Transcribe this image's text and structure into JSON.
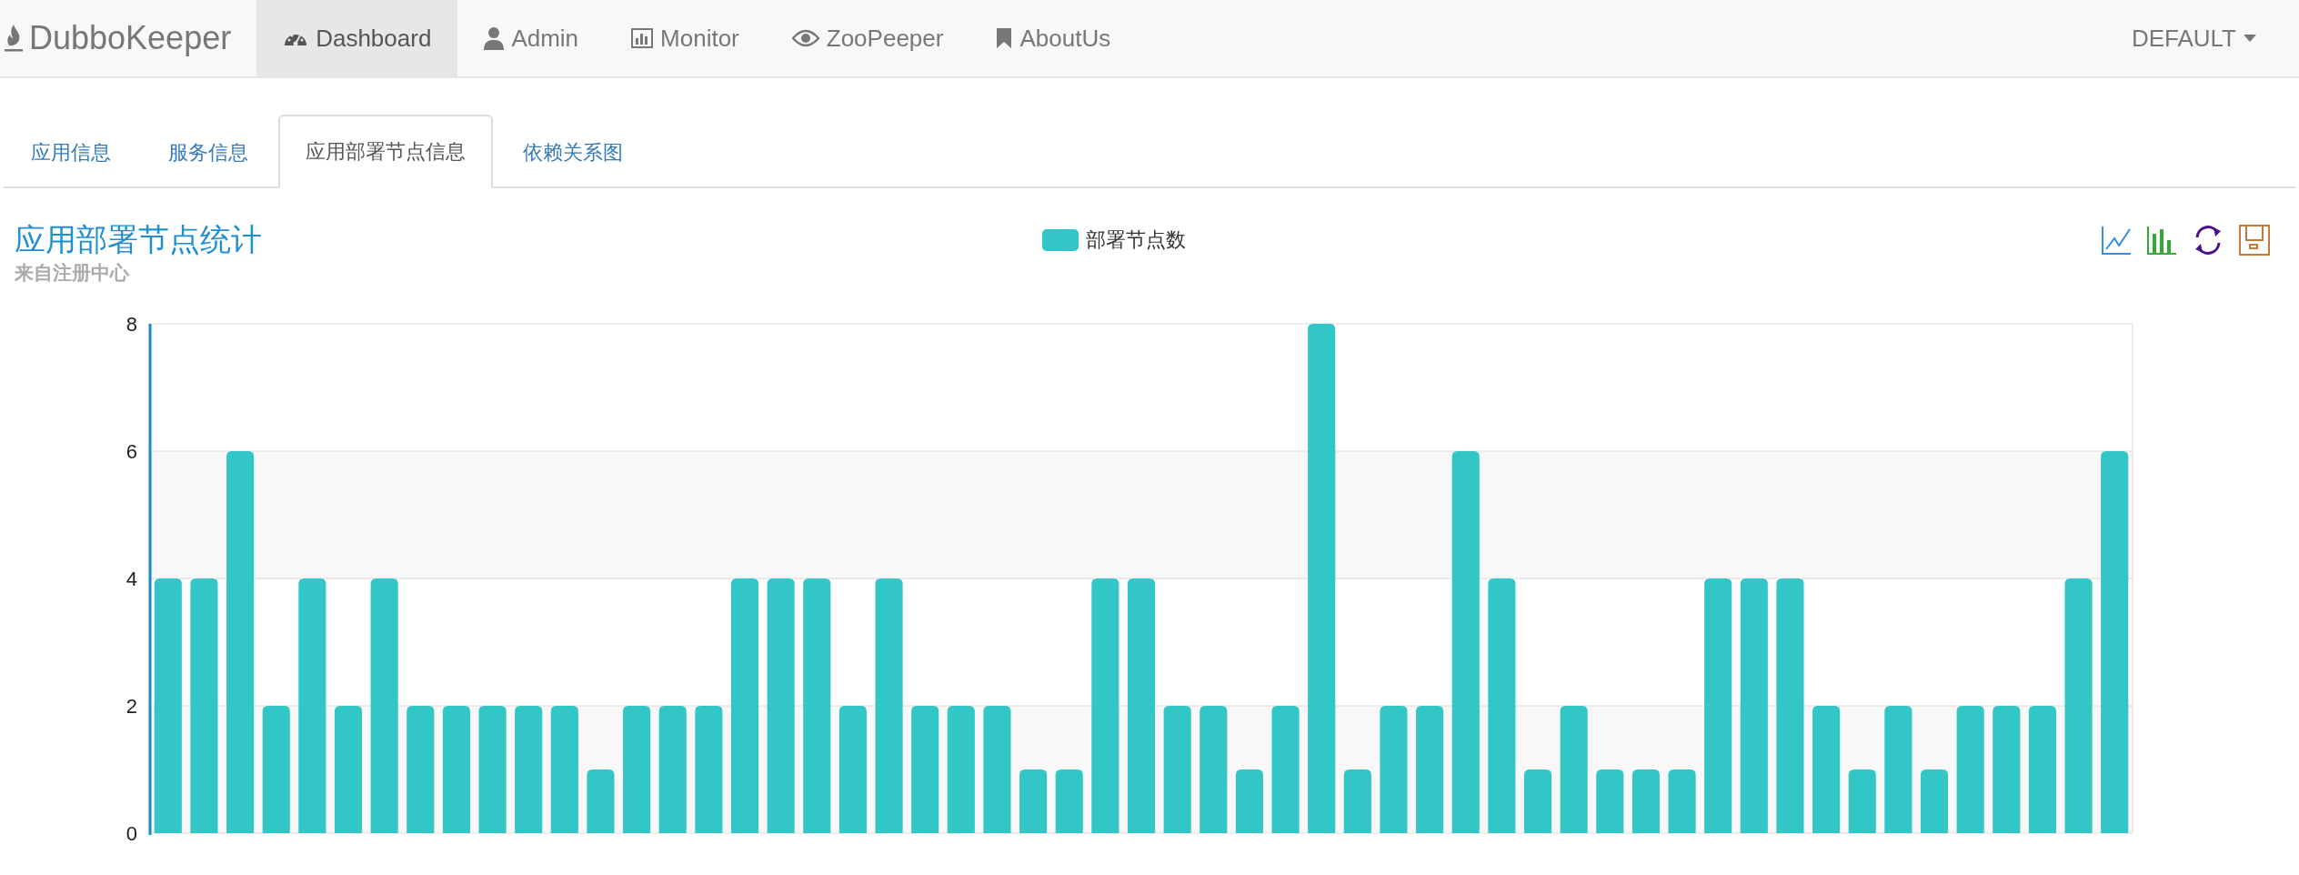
{
  "navbar": {
    "brand": "DubboKeeper",
    "items": [
      {
        "label": "Dashboard",
        "kind": "dashboard",
        "selected": true
      },
      {
        "label": "Admin",
        "kind": "user",
        "selected": false
      },
      {
        "label": "Monitor",
        "kind": "stats",
        "selected": false
      },
      {
        "label": "ZooPeeper",
        "kind": "eye",
        "selected": false
      },
      {
        "label": "AboutUs",
        "kind": "bookmark",
        "selected": false
      }
    ],
    "dropdown": "DEFAULT"
  },
  "tabs": [
    {
      "label": "应用信息",
      "selected": false
    },
    {
      "label": "服务信息",
      "selected": false
    },
    {
      "label": "应用部署节点信息",
      "selected": true
    },
    {
      "label": "依赖关系图",
      "selected": false
    }
  ],
  "chart_panel": {
    "title": "应用部署节点统计",
    "subtitle": "来自注册中心",
    "toolbox": [
      {
        "kind": "line"
      },
      {
        "kind": "bar"
      },
      {
        "kind": "refresh"
      },
      {
        "kind": "save"
      }
    ],
    "chart_data": {
      "type": "bar",
      "grid": true,
      "ylim": [
        0,
        8
      ],
      "yticks": [
        0,
        2,
        4,
        6,
        8
      ],
      "series": [
        {
          "name": "部署节点数",
          "color": "#33c6c6",
          "values": [
            4,
            4,
            6,
            2,
            4,
            2,
            4,
            2,
            2,
            2,
            2,
            2,
            1,
            2,
            2,
            2,
            4,
            4,
            4,
            2,
            4,
            2,
            2,
            2,
            1,
            1,
            4,
            4,
            2,
            2,
            1,
            2,
            8,
            1,
            2,
            2,
            6,
            4,
            1,
            2,
            1,
            1,
            1,
            4,
            4,
            4,
            2,
            1,
            2,
            1,
            2,
            2,
            2,
            4,
            6
          ]
        }
      ]
    }
  }
}
